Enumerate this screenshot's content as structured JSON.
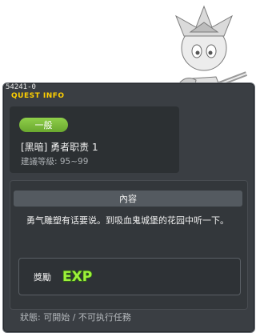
{
  "quest": {
    "id": "54241-0",
    "panel_title": "QUEST INFO",
    "category_badge": "一般",
    "name": "[黑暗] 勇者职责 1",
    "level_requirement": "建議等級: 95~99"
  },
  "content": {
    "header": "內容",
    "description": "勇气雕塑有话要说。到吸血鬼城堡的花园中听一下。"
  },
  "reward": {
    "label": "獎勵",
    "exp_text": "EXP"
  },
  "status": {
    "text": "狀態: 可開始 / 不可执行任務"
  },
  "colors": {
    "title_yellow": "#ffd000",
    "badge_green": "#7cbf3c",
    "window_bg": "#3a3e43"
  }
}
